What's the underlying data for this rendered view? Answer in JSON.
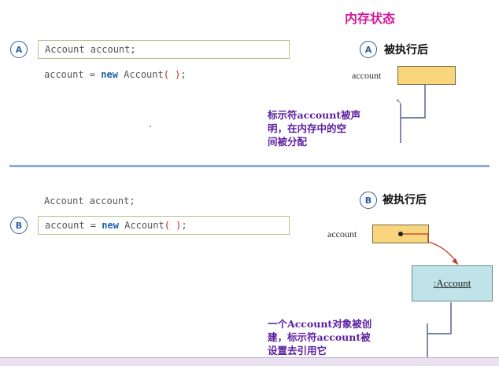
{
  "header": {
    "memory_state": "内存状态"
  },
  "section_a": {
    "marker": "A",
    "decl_line": "Account account;",
    "assign_parts": {
      "lhs": "account = ",
      "kw": "new",
      "cls": " Account",
      "args": "( )",
      "end": ";"
    },
    "after_marker": "A",
    "after_label": "被执行后",
    "var_name": "account",
    "note": [
      "标示符account被声",
      "明，在内存中的空",
      "间被分配"
    ]
  },
  "section_b": {
    "marker": "B",
    "decl_line": "Account account;",
    "assign_parts": {
      "lhs": "account = ",
      "kw": "new",
      "cls": " Account",
      "args": "( )",
      "end": ";"
    },
    "after_marker": "B",
    "after_label": "被执行后",
    "var_name": "account",
    "object_label": ":Account",
    "note": [
      "一个Account对象被创",
      "建，标示符account被",
      "设置去引用它"
    ]
  },
  "colors": {
    "heading": "#d4179a",
    "note": "#5b1ea0",
    "memory_cell": "#f9d57e",
    "object": "#bfe3e8",
    "divider": "#8aaed6",
    "arrow": "#c0392b"
  }
}
